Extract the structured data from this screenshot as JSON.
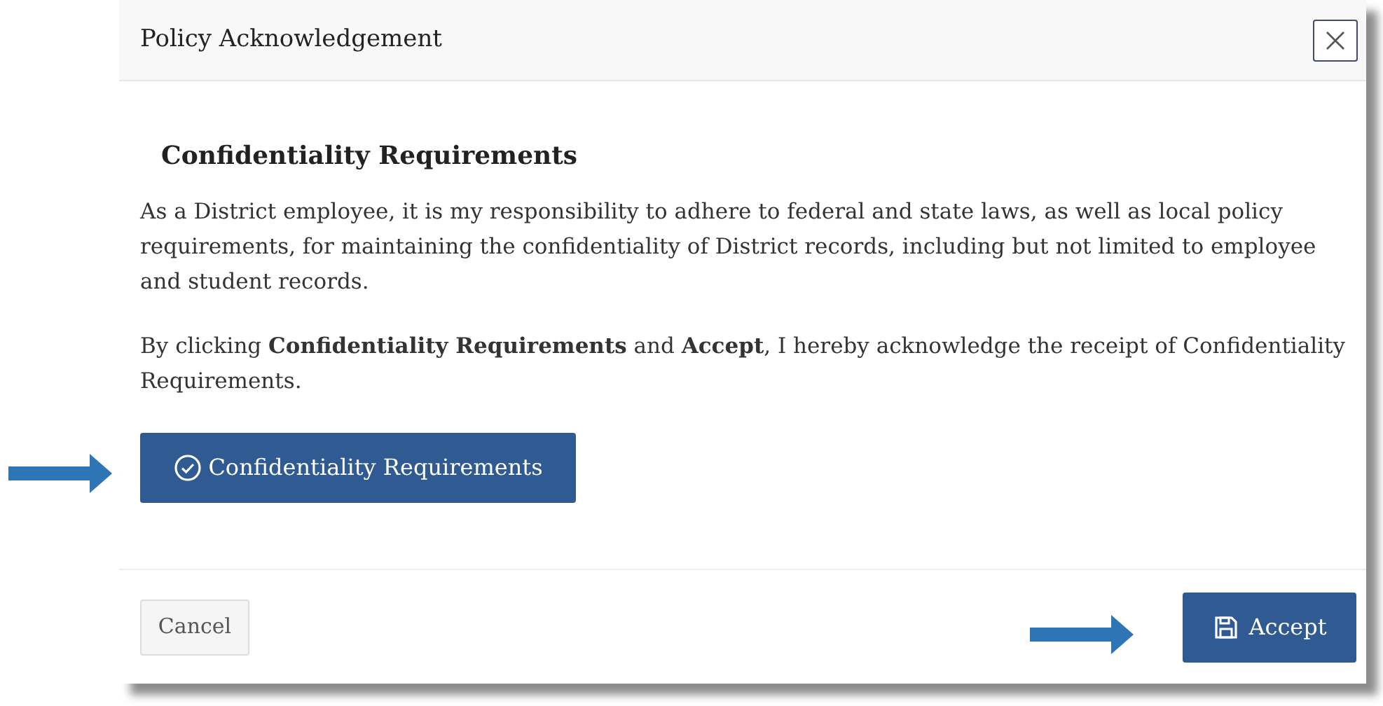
{
  "dialog": {
    "title": "Policy Acknowledgement",
    "heading": "Confidentiality Requirements",
    "paragraphs": [
      "As a District employee, it is my responsibility to adhere to federal and state laws, as well as local policy requirements, for maintaining the confidentiality of District records, including but not limited to employee and student records.",
      "By clicking **Confidentiality Requirements** and **Accept**, I hereby acknowledge the receipt of Confidentiality Requirements."
    ],
    "document_button": {
      "label": "Confidentiality Requirements"
    },
    "cancel_button": {
      "label": "Cancel"
    },
    "accept_button": {
      "label": "Accept"
    }
  }
}
